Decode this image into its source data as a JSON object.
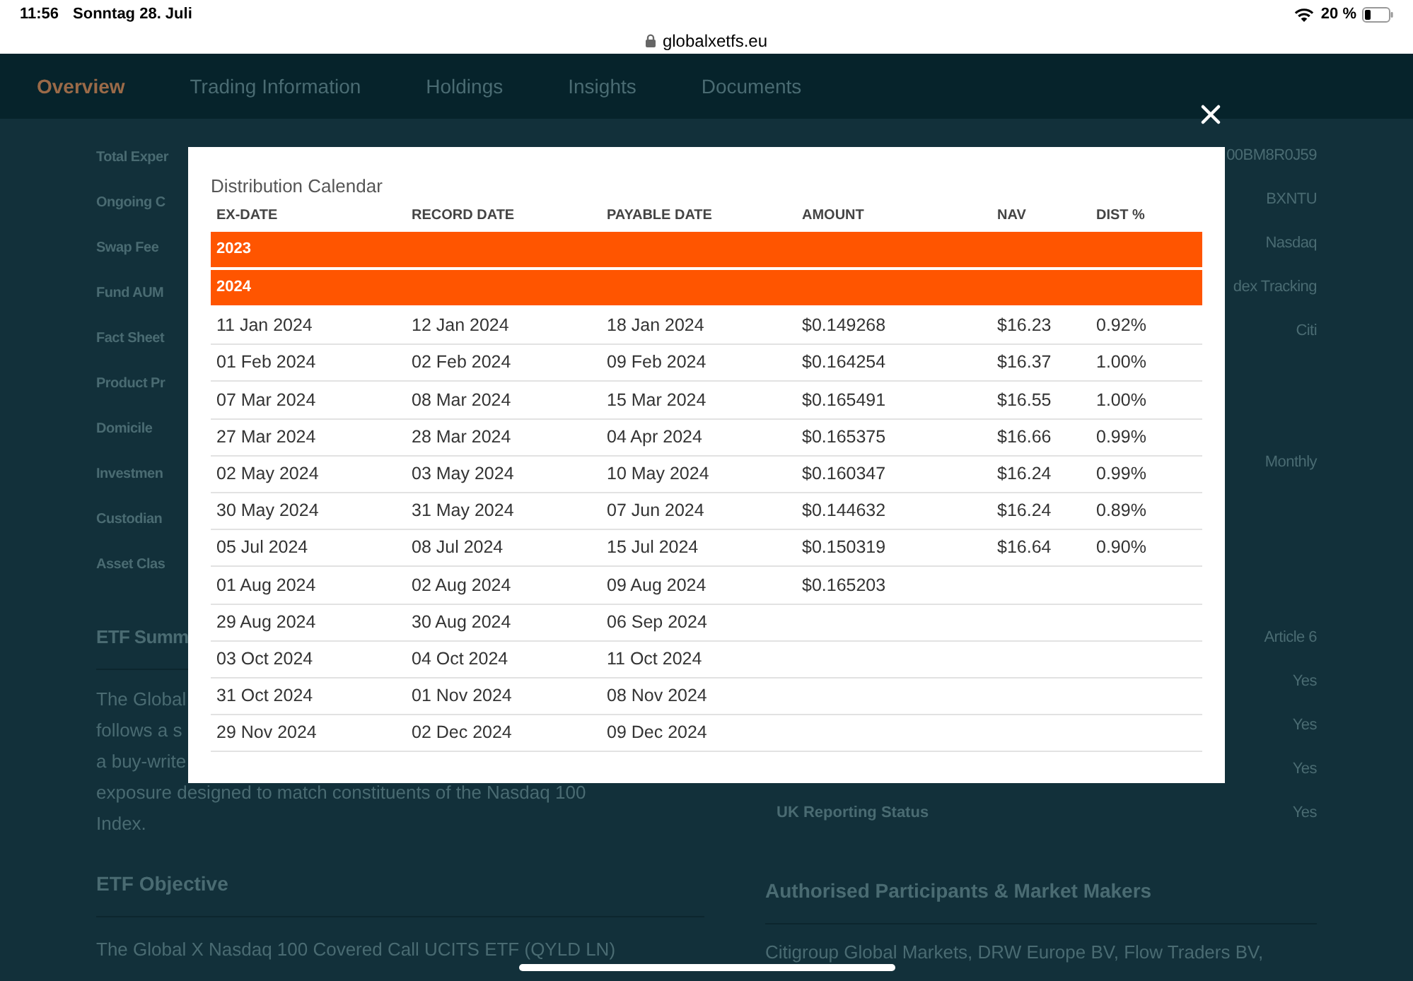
{
  "status_bar": {
    "time": "11:56",
    "date": "Sonntag 28. Juli",
    "url": "globalxetfs.eu",
    "battery": "20 %"
  },
  "nav": [
    {
      "label": "Overview",
      "selected": true
    },
    {
      "label": "Trading Information",
      "selected": false
    },
    {
      "label": "Holdings",
      "selected": false
    },
    {
      "label": "Insights",
      "selected": false
    },
    {
      "label": "Documents",
      "selected": false
    }
  ],
  "fund_details_left": [
    "Total Exper",
    "Ongoing C",
    "Swap Fee",
    "Fund AUM",
    "Fact Sheet",
    "Product Pr",
    "Domicile",
    "Investmen",
    "Custodian",
    "Asset Clas"
  ],
  "fund_details_right_top": [
    {
      "value": "00BM8R0J59"
    },
    {
      "value": "BXNTU"
    },
    {
      "value": "Nasdaq"
    },
    {
      "value": "dex Tracking"
    },
    {
      "value": "Citi"
    }
  ],
  "fund_details_right_middle": [
    {
      "value": "Monthly"
    }
  ],
  "fund_details_right_bottom": [
    {
      "value": "Article 6"
    },
    {
      "value": "Yes"
    },
    {
      "value": "Yes"
    },
    {
      "value": "Yes"
    },
    {
      "label": "UK Reporting Status",
      "value": "Yes"
    }
  ],
  "etf_summary": {
    "title": "ETF Summ",
    "lines": [
      "The Global",
      "follows a s",
      "a buy-write",
      "exposure designed to match constituents of the Nasdaq 100",
      "Index."
    ]
  },
  "etf_objective": {
    "title": "ETF Objective",
    "lines": [
      "The Global X Nasdaq 100 Covered Call UCITS ETF (QYLD LN)"
    ]
  },
  "participants": {
    "title": "Authorised Participants & Market Makers",
    "lines": [
      "Citigroup Global Markets, DRW Europe BV, Flow Traders BV,"
    ]
  },
  "dialog": {
    "title": "Distribution Calendar",
    "columns": [
      "EX-DATE",
      "RECORD DATE",
      "PAYABLE DATE",
      "AMOUNT",
      "NAV",
      "DIST %"
    ],
    "groups": [
      {
        "year": "2023"
      },
      {
        "year": "2024",
        "rows": [
          [
            "11 Jan 2024",
            "12 Jan 2024",
            "18 Jan 2024",
            "$0.149268",
            "$16.23",
            "0.92%"
          ],
          [
            "01 Feb 2024",
            "02 Feb 2024",
            "09 Feb 2024",
            "$0.164254",
            "$16.37",
            "1.00%"
          ],
          [
            "07 Mar 2024",
            "08 Mar 2024",
            "15 Mar 2024",
            "$0.165491",
            "$16.55",
            "1.00%"
          ],
          [
            "27 Mar 2024",
            "28 Mar 2024",
            "04 Apr 2024",
            "$0.165375",
            "$16.66",
            "0.99%"
          ],
          [
            "02 May 2024",
            "03 May 2024",
            "10 May 2024",
            "$0.160347",
            "$16.24",
            "0.99%"
          ],
          [
            "30 May 2024",
            "31 May 2024",
            "07 Jun 2024",
            "$0.144632",
            "$16.24",
            "0.89%"
          ],
          [
            "05 Jul 2024",
            "08 Jul 2024",
            "15 Jul 2024",
            "$0.150319",
            "$16.64",
            "0.90%"
          ],
          [
            "01 Aug 2024",
            "02 Aug 2024",
            "09 Aug 2024",
            "$0.165203"
          ],
          [
            "29 Aug 2024",
            "30 Aug 2024",
            "06 Sep 2024"
          ],
          [
            "03 Oct 2024",
            "04 Oct 2024",
            "11 Oct 2024"
          ],
          [
            "31 Oct 2024",
            "01 Nov 2024",
            "08 Nov 2024"
          ],
          [
            "29 Nov 2024",
            "02 Dec 2024",
            "09 Dec 2024"
          ]
        ]
      }
    ]
  }
}
